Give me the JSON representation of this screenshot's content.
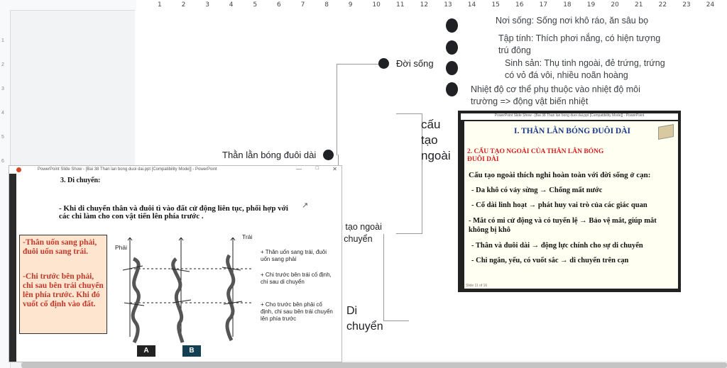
{
  "ruler": {
    "marks": [
      "1",
      "2",
      "3",
      "4",
      "5",
      "6",
      "7",
      "8",
      "9",
      "10",
      "11",
      "12",
      "13",
      "14",
      "15",
      "16",
      "17",
      "18",
      "19",
      "20",
      "21",
      "22",
      "23",
      "24"
    ]
  },
  "map": {
    "root": "Thằn lằn bóng đuôi dài",
    "branch_life": "Đời sống",
    "leaf_habitat": "Nơi sống: Sống nơi khô ráo, ăn sâu bọ",
    "leaf_behavior": "Tập tính: Thích phơi nắng, có hiện tượng trú đông",
    "leaf_repro": "Sinh sản: Thụ tinh ngoài, đẻ trứng, trứng có vỏ đá vôi, nhiều noãn hoàng",
    "leaf_temp": "Nhiệt độ cơ thể phụ thuộc vào nhiệt độ môi trường => động vật biến nhiệt",
    "branch_partial_1": "u tạo ngoài",
    "branch_partial_2": "i chuyển",
    "structure_label": "cấu tạo ngoài",
    "movement_label": "Di chuyển"
  },
  "slide_right": {
    "title_bar": "PowerPoint Slide Show - [Bai 38 Than lan bong duoi dai.ppt [Compatibility Mode]] - PowerPoint",
    "heading": "I. THẰN LẰN BÓNG ĐUÔI DÀI",
    "sub": "2. CẤU TẠO NGOÀI CỦA THẰN LẰN BÓNG ĐUÔI DÀI",
    "intro": "Cấu tạo ngoài thích nghi hoàn toàn với đời sống ở cạn:",
    "items": [
      "- Da khô có vảy sừng → Chống mất nước",
      "- Cổ dài linh hoạt → phát huy vai trò của các giác quan",
      "- Mắt có mi cử động và có tuyến lệ → Bảo vệ mắt, giúp mắt không bị khô",
      "- Thân và đuôi dài → động lực chính cho sự di chuyển",
      "- Chi ngắn, yếu, có vuốt sắc → di chuyển trên cạn"
    ],
    "slide_num": "Slide 11 of 16"
  },
  "slide_left": {
    "title_bar": "PowerPoint Slide Show - [Bai 38 Than lan bong duoi dai.ppt [Compatibility Mode]] - PowerPoint",
    "heading": "3. Di chuyển:",
    "text": "- Khi di chuyển thân và đuôi tì vào đất cử động liên tục, phối hợp với các chi làm cho con vật tiến lên phía trước .",
    "box_1": "-Thân uốn sang phải, đuôi uốn sang trái.",
    "box_2": "-Chi trước bên phải, chi sau bên trái chuyển lên phía trước. Khi đó vuốt cố định vào đất.",
    "label_left": "Phải",
    "label_right": "Trái",
    "note_1": "+ Thân uốn sang trái, đuôi uốn sang phải",
    "note_2": "+ Chi trước bên trái cố định, chi sau di chuyển",
    "note_3": "+ Cho trước bên phải cố định, chi sau bên trái chuyển lên phía trước",
    "tag_a": "A",
    "tag_b": "B"
  }
}
